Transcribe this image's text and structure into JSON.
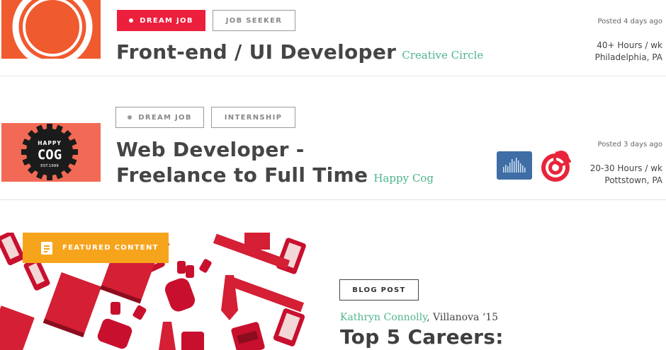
{
  "jobs": [
    {
      "tags": [
        {
          "label": "DREAM JOB",
          "style": "red",
          "dot": true
        },
        {
          "label": "JOB SEEKER",
          "style": "plain",
          "dot": false
        }
      ],
      "title": "Front-end / UI Developer",
      "company": "Creative Circle",
      "posted": "Posted 4 days ago",
      "hours": "40+ Hours / wk",
      "location": "Philadelphia, PA",
      "logo": "circle-logo"
    },
    {
      "tags": [
        {
          "label": "DREAM JOB",
          "style": "plain",
          "dot": true
        },
        {
          "label": "INTERNSHIP",
          "style": "plain",
          "dot": false
        }
      ],
      "title_line1": "Web Developer -",
      "title_line2": "Freelance to Full Time",
      "company": "Happy Cog",
      "posted": "Posted 3 days ago",
      "hours": "20-30 Hours / wk",
      "location": "Pottstown, PA",
      "logo": {
        "top": "HAPPY",
        "main": "COG",
        "sub": "EST.1999"
      },
      "service_icons": [
        "bar-chart-icon",
        "target-icon"
      ]
    }
  ],
  "featured": {
    "badge": "FEATURED CONTENT",
    "category": "BLOG POST",
    "author": "Kathryn Connolly",
    "affiliation": ", Villanova ‘15",
    "title": "Top 5 Careers:"
  },
  "colors": {
    "accent_red": "#ec1f3d",
    "accent_green": "#4fb58c",
    "featured_orange": "#f7a41d",
    "logo_orange": "#f05a2f",
    "logo_salmon": "#f26a55"
  }
}
